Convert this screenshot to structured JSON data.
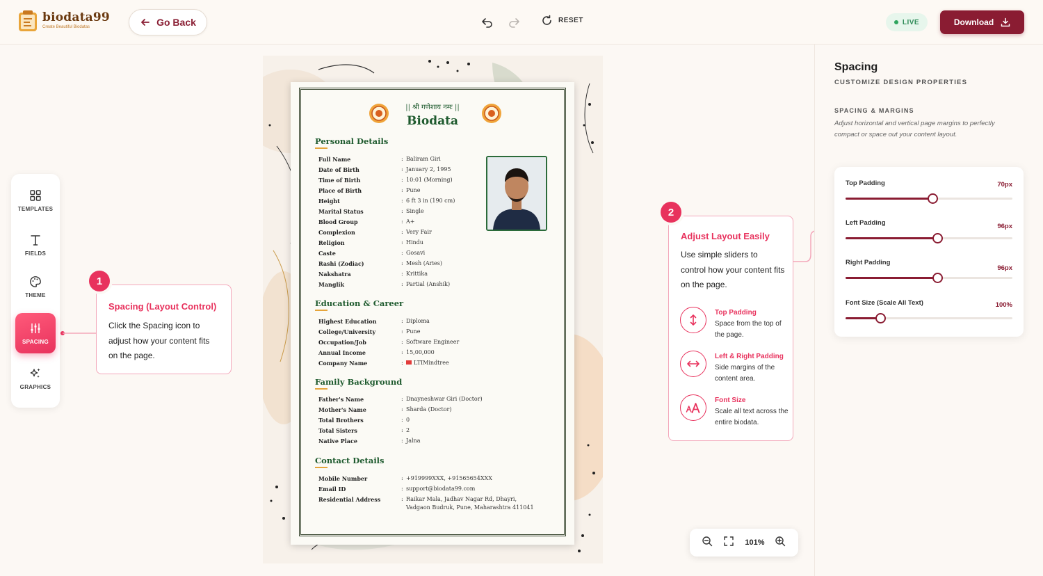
{
  "header": {
    "logo_name": "biodata99",
    "logo_tagline": "Create Beautiful Biodatas",
    "go_back_label": "Go Back",
    "reset_label": "RESET",
    "live_label": "LIVE",
    "download_label": "Download"
  },
  "toolbar": {
    "items": [
      {
        "label": "TEMPLATES",
        "icon": "grid-icon"
      },
      {
        "label": "FIELDS",
        "icon": "text-icon"
      },
      {
        "label": "THEME",
        "icon": "palette-icon"
      },
      {
        "label": "SPACING",
        "icon": "sliders-icon",
        "active": true
      },
      {
        "label": "GRAPHICS",
        "icon": "sparkle-icon"
      }
    ]
  },
  "callout1": {
    "number": "1",
    "title": "Spacing (Layout Control)",
    "body": "Click the Spacing icon to adjust how your content fits on the page."
  },
  "callout2": {
    "number": "2",
    "title": "Adjust Layout Easily",
    "body": "Use simple sliders to control how your content fits on the page.",
    "features": [
      {
        "title": "Top Padding",
        "desc": "Space from the top of the page."
      },
      {
        "title": "Left & Right Padding",
        "desc": "Side margins of the content area."
      },
      {
        "title": "Font Size",
        "desc": "Scale all text across the entire biodata."
      }
    ]
  },
  "biodata": {
    "mantra": "|| श्री गणेशाय नमः ||",
    "title": "Biodata",
    "sections": [
      {
        "heading": "Personal Details",
        "rows": [
          {
            "label": "Full Name",
            "value": "Baliram Giri"
          },
          {
            "label": "Date of Birth",
            "value": "January 2, 1995"
          },
          {
            "label": "Time of Birth",
            "value": "10:01 (Morning)"
          },
          {
            "label": "Place of Birth",
            "value": "Pune"
          },
          {
            "label": "Height",
            "value": "6 ft 3 in (190 cm)"
          },
          {
            "label": "Marital Status",
            "value": "Single"
          },
          {
            "label": "Blood Group",
            "value": "A+"
          },
          {
            "label": "Complexion",
            "value": "Very Fair"
          },
          {
            "label": "Religion",
            "value": "Hindu"
          },
          {
            "label": "Caste",
            "value": "Gosavi"
          },
          {
            "label": "Rashi (Zodiac)",
            "value": "Mesh (Aries)"
          },
          {
            "label": "Nakshatra",
            "value": "Krittika"
          },
          {
            "label": "Manglik",
            "value": "Partial (Anshik)"
          }
        ]
      },
      {
        "heading": "Education & Career",
        "rows": [
          {
            "label": "Highest Education",
            "value": "Diploma"
          },
          {
            "label": "College/University",
            "value": "Pune"
          },
          {
            "label": "Occupation/Job",
            "value": "Software Engineer"
          },
          {
            "label": "Annual Income",
            "value": "15,00,000"
          },
          {
            "label": "Company Name",
            "value": "LTIMindtree"
          }
        ]
      },
      {
        "heading": "Family Background",
        "rows": [
          {
            "label": "Father's Name",
            "value": "Dnayneshwar Giri (Doctor)"
          },
          {
            "label": "Mother's Name",
            "value": "Sharda (Doctor)"
          },
          {
            "label": "Total Brothers",
            "value": "0"
          },
          {
            "label": "Total Sisters",
            "value": "2"
          },
          {
            "label": "Native Place",
            "value": "Jalna"
          }
        ]
      },
      {
        "heading": "Contact Details",
        "rows": [
          {
            "label": "Mobile Number",
            "value": "+919999XXX, +91565654XXX"
          },
          {
            "label": "Email ID",
            "value": "support@biodata99.com"
          },
          {
            "label": "Residential Address",
            "value": "Raikar Mala, Jadhav Nagar Rd, Dhayri,"
          },
          {
            "label": "",
            "value": "Vadgaon Budruk, Pune, Maharashtra 411041"
          }
        ]
      }
    ]
  },
  "zoom": {
    "level": "101%"
  },
  "panel": {
    "title": "Spacing",
    "subtitle": "CUSTOMIZE DESIGN PROPERTIES",
    "section_title": "SPACING & MARGINS",
    "section_desc": "Adjust horizontal and vertical page margins to perfectly compact or space out your content layout.",
    "sliders": [
      {
        "label": "Top Padding",
        "value": "70px",
        "fraction": 0.52
      },
      {
        "label": "Left Padding",
        "value": "96px",
        "fraction": 0.55
      },
      {
        "label": "Right Padding",
        "value": "96px",
        "fraction": 0.55
      },
      {
        "label": "Font Size (Scale All Text)",
        "value": "100%",
        "fraction": 0.21
      }
    ]
  },
  "colors": {
    "brand": "#8a1c32",
    "accent": "#e8325d",
    "biodata_green": "#1e5a2e",
    "live_green": "#2ea55e"
  }
}
